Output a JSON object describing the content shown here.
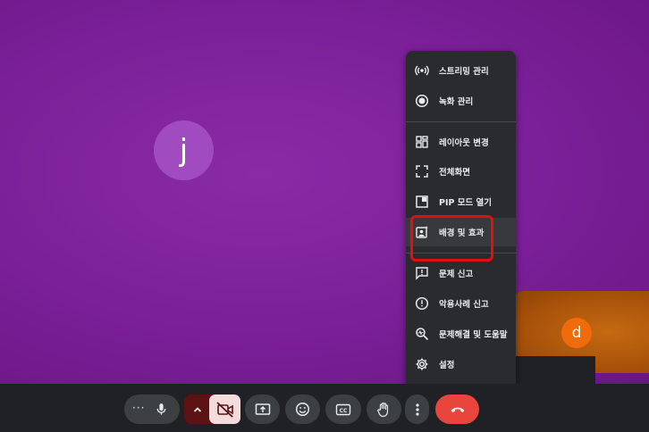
{
  "participants": {
    "main_initial": "j",
    "self_initial": "d"
  },
  "menu": {
    "items": [
      {
        "label": "스트리밍 관리",
        "icon": "broadcast-icon"
      },
      {
        "label": "녹화 관리",
        "icon": "record-icon"
      },
      {
        "label": "레이아웃 변경",
        "icon": "layout-icon"
      },
      {
        "label": "전체화면",
        "icon": "fullscreen-icon"
      },
      {
        "label": "PIP 모드 열기",
        "icon": "pip-icon"
      },
      {
        "label": "배경 및 효과",
        "icon": "background-effects-icon"
      },
      {
        "label": "문제 신고",
        "icon": "report-problem-icon"
      },
      {
        "label": "악용사례 신고",
        "icon": "report-abuse-icon"
      },
      {
        "label": "문제해결 및 도움말",
        "icon": "troubleshoot-icon"
      },
      {
        "label": "설정",
        "icon": "settings-icon"
      }
    ]
  },
  "toolbar": {
    "more_dots": "···",
    "buttons": [
      "mic-icon",
      "chevron-up-icon",
      "camera-off-icon",
      "present-screen-icon",
      "emoji-icon",
      "captions-icon",
      "raise-hand-icon",
      "more-options-icon",
      "end-call-icon"
    ]
  },
  "colors": {
    "stage": "#7a1f97",
    "highlight": "#e01010",
    "end_call": "#e8453c"
  }
}
